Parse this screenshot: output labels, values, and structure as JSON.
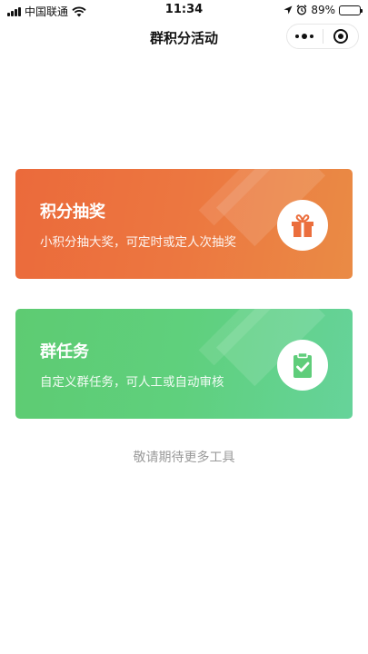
{
  "status_bar": {
    "carrier": "中国联通",
    "time": "11:34",
    "battery_percent": "89%",
    "battery_level": 0.89
  },
  "nav": {
    "title": "群积分活动"
  },
  "cards": [
    {
      "title": "积分抽奖",
      "description": "小积分抽大奖，可定时或定人次抽奖",
      "icon": "gift-icon",
      "color": "#eb6e3d"
    },
    {
      "title": "群任务",
      "description": "自定义群任务，可人工或自动审核",
      "icon": "clipboard-check-icon",
      "color": "#5fcd7a"
    }
  ],
  "footer": {
    "more_tools": "敬请期待更多工具"
  }
}
